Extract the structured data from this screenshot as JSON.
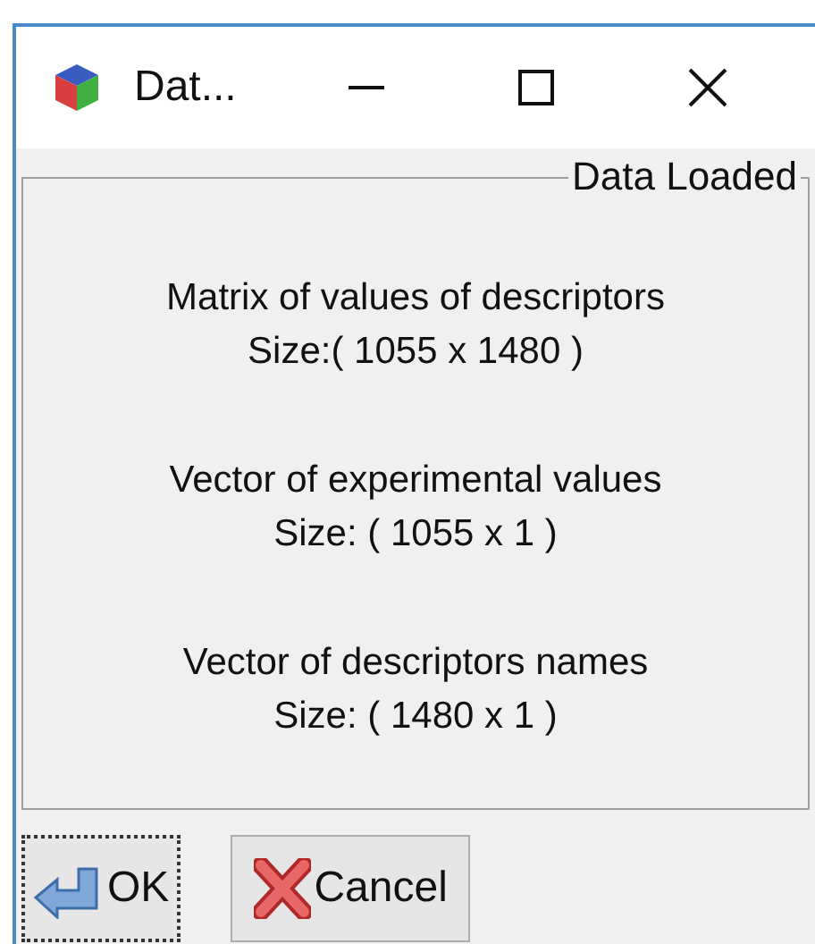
{
  "window": {
    "title": "Dat..."
  },
  "group": {
    "title": "Data Loaded"
  },
  "items": [
    {
      "label": "Matrix of values of descriptors",
      "size": "Size:( 1055 x 1480 )"
    },
    {
      "label": "Vector of experimental values",
      "size": "Size: ( 1055 x 1 )"
    },
    {
      "label": "Vector of descriptors names",
      "size": "Size: ( 1480 x 1 )"
    }
  ],
  "buttons": [
    {
      "kind": "ok",
      "label": "OK",
      "focused": true
    },
    {
      "kind": "cancel",
      "label": "Cancel",
      "focused": false
    }
  ]
}
